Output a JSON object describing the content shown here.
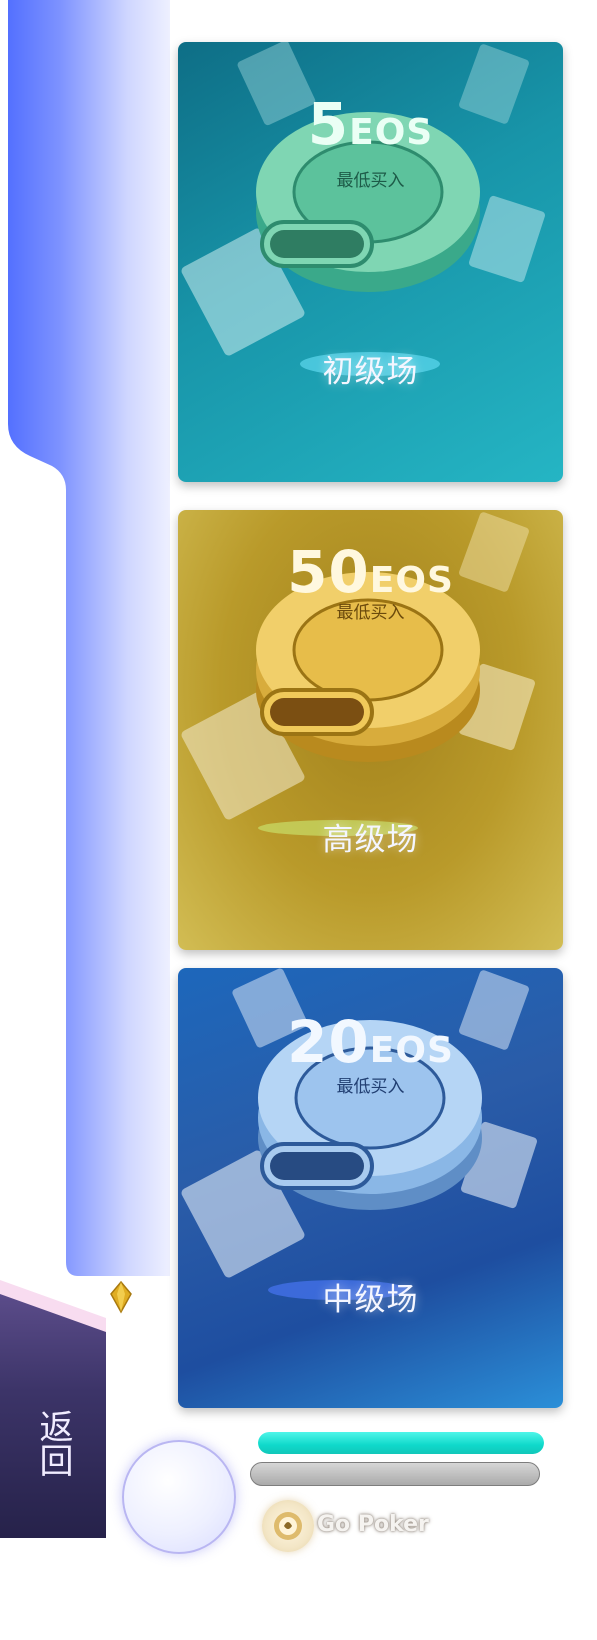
{
  "rooms": [
    {
      "id": "beginner",
      "amount": "5",
      "unit": "EOS",
      "min_buy_label": "最低买入",
      "name": "初级场",
      "theme": "teal"
    },
    {
      "id": "advanced",
      "amount": "50",
      "unit": "EOS",
      "min_buy_label": "最低买入",
      "name": "高级场",
      "theme": "gold"
    },
    {
      "id": "intermediate",
      "amount": "20",
      "unit": "EOS",
      "min_buy_label": "最低买入",
      "name": "中级场",
      "theme": "blue"
    }
  ],
  "back_button": {
    "label": "返回"
  },
  "player": {
    "progress": 1.0
  },
  "brand": {
    "name": "Go Poker"
  },
  "colors": {
    "panel_blue": "#5b78ff",
    "teal_card": "#1895a9",
    "gold_card": "#b99a2a",
    "blue_card": "#2a5ca8",
    "progress": "#11d8c9",
    "back_button": "#2e2852"
  }
}
